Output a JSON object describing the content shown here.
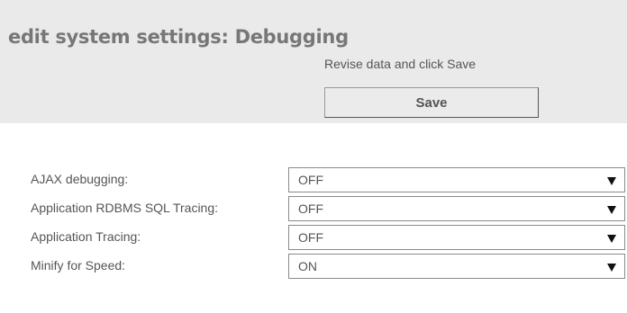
{
  "header": {
    "title": "edit system settings: Debugging",
    "instruction": "Revise data and click Save",
    "save_label": "Save"
  },
  "settings": [
    {
      "label": "AJAX debugging:",
      "value": "OFF"
    },
    {
      "label": "Application RDBMS SQL Tracing:",
      "value": "OFF"
    },
    {
      "label": "Application Tracing:",
      "value": "OFF"
    },
    {
      "label": "Minify for Speed:",
      "value": "ON"
    }
  ],
  "icons": {
    "dropdown": "chevron-down-icon"
  }
}
